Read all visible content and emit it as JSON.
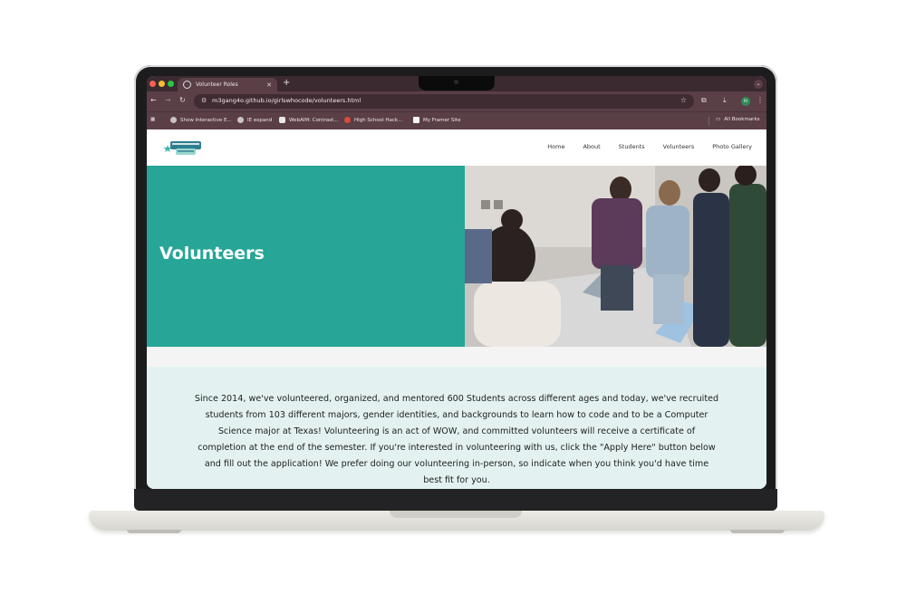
{
  "browser": {
    "tab_title": "Volunteer Roles",
    "new_tab_label": "+",
    "url": "m3gang4o.github.io/girlswhocode/volunteers.html",
    "bookmarks": [
      {
        "label": "Show Interactive E..."
      },
      {
        "label": "IE expand"
      },
      {
        "label": "WebAIM: Contrast..."
      },
      {
        "label": "High School Hack..."
      },
      {
        "label": "My Framer Site"
      }
    ],
    "all_bookmarks_label": "All Bookmarks",
    "profile_initials": "RI"
  },
  "site": {
    "nav": [
      "Home",
      "About",
      "Students",
      "Volunteers",
      "Photo Gallery"
    ],
    "hero_title": "Volunteers",
    "intro": "Since 2014, we've volunteered, organized, and mentored 600 Students across different ages and today, we've recruited students from 103 different majors, gender identities, and backgrounds to learn how to code and to be a Computer Science major at Texas! Volunteering is an act of WOW, and committed volunteers will receive a certificate of completion at the end of the semester. If you're interested in volunteering with us, click the \"Apply Here\" button below and fill out the application! We prefer doing our volunteering in-person, so indicate when you think you'd have time best fit for you."
  },
  "colors": {
    "hero_teal": "#27a597",
    "intro_bg": "#e3f2f0",
    "tabstrip": "#3b2a30",
    "toolbar": "#5a3f47"
  }
}
